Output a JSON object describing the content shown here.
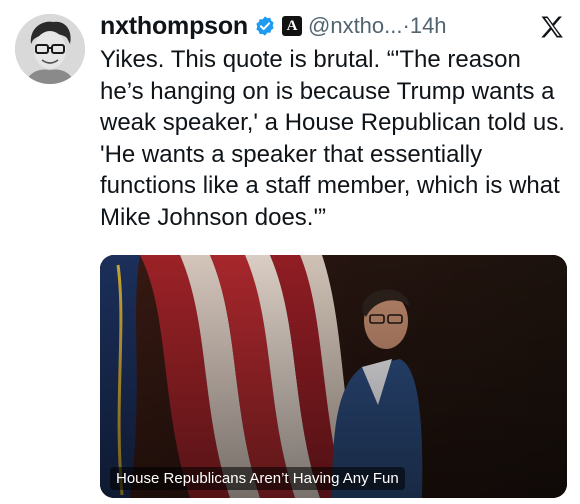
{
  "tweet": {
    "display_name": "nxthompson",
    "verified_icon": "verified-badge-icon",
    "affiliate_badge": "A",
    "handle": "@nxtho...",
    "separator": "·",
    "time": "14h",
    "platform_icon": "x-logo-icon",
    "text": "Yikes. This quote is brutal. “'The reason he’s hanging on is because Trump wants a weak speaker,' a House Republican told us. 'He wants a speaker that essentially functions like a staff member, which is what Mike Johnson does.'”",
    "media": {
      "caption": "House Republicans Aren’t Having Any Fun"
    }
  },
  "colors": {
    "verified_blue": "#1d9bf0",
    "text": "#0f1419",
    "secondary": "#536471"
  }
}
